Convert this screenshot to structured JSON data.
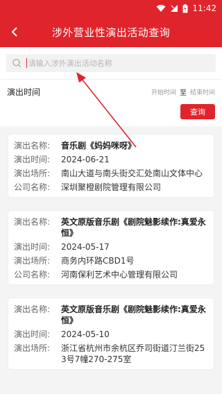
{
  "status": {
    "time": "11:42"
  },
  "header": {
    "title": "涉外营业性演出活动查询"
  },
  "search": {
    "placeholder": "请输入涉外演出活动名称"
  },
  "filter": {
    "label": "演出时间",
    "start_placeholder": "开始时间",
    "separator": "至",
    "end_placeholder": "结束时间",
    "query_button": "查询"
  },
  "field_labels": {
    "name": "演出名称:",
    "time": "演出时间:",
    "venue": "演出场所:",
    "company": "公司名称:"
  },
  "records": [
    {
      "name": "音乐剧《妈妈咪呀》",
      "time": "2024-06-21",
      "venue": "南山大道与南头街交汇处南山文体中心",
      "company": "深圳聚橙剧院管理有限公司"
    },
    {
      "name": "英文原版音乐剧《剧院魅影续作:真爱永恒》",
      "time": "2024-05-17",
      "venue": "商务内环路CBD1号",
      "company": "河南保利艺术中心管理有限公司"
    },
    {
      "name": "英文原版音乐剧《剧院魅影续作:真爱永恒》",
      "time": "2024-05-10",
      "venue": "浙江省杭州市余杭区乔司街道汀兰街253号7幢270-275室"
    }
  ],
  "colors": {
    "brand": "#e0242c",
    "annotation_arrow": "#e0242c"
  }
}
